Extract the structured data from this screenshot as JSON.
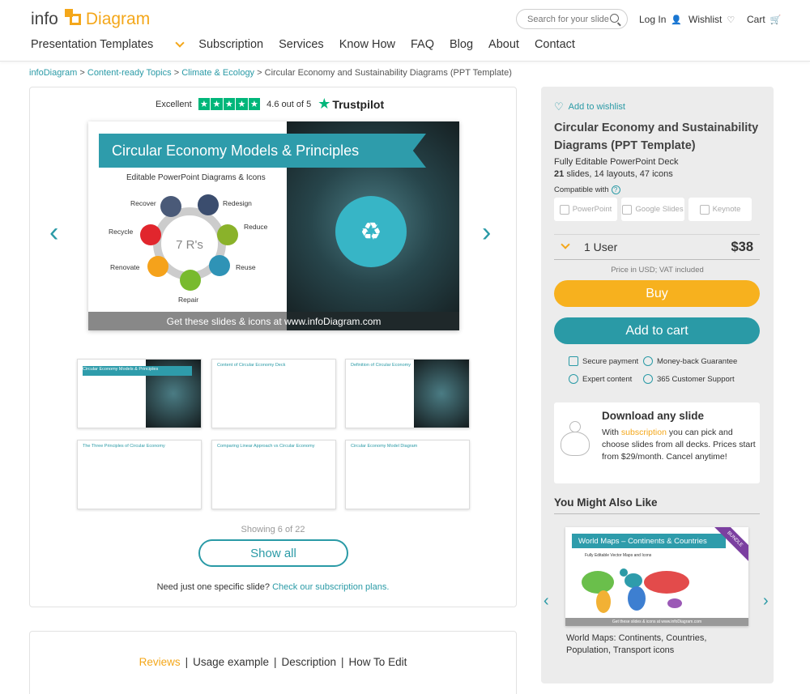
{
  "header": {
    "logo_info": "info",
    "logo_diagram": "Diagram",
    "search_placeholder": "Search for your slide",
    "login": "Log In",
    "wishlist": "Wishlist",
    "cart": "Cart",
    "nav": [
      "Presentation Templates",
      "Subscription",
      "Services",
      "Know How",
      "FAQ",
      "Blog",
      "About",
      "Contact"
    ]
  },
  "breadcrumb": {
    "items": [
      "infoDiagram",
      "Content-ready Topics",
      "Climate & Ecology"
    ],
    "current": "Circular Economy and Sustainability Diagrams (PPT Template)",
    "sep": ">"
  },
  "trustpilot": {
    "excellent": "Excellent",
    "score": "4.6 out of 5",
    "brand": "Trustpilot"
  },
  "hero": {
    "title": "Circular Economy Models & Principles",
    "subtitle": "Editable PowerPoint Diagrams & Icons",
    "center": "7 R's",
    "labels": [
      "Recover",
      "Redesign",
      "Reduce",
      "Reuse",
      "Repair",
      "Renovate",
      "Recycle"
    ],
    "footer": "Get these slides & icons at www.infoDiagram.com"
  },
  "thumbs": [
    {
      "title": "Circular Economy Models & Principles"
    },
    {
      "title": "Content of Circular Economy Deck"
    },
    {
      "title": "Definition of Circular Economy"
    },
    {
      "title": "The Three Principles of Circular Economy"
    },
    {
      "title": "Comparing Linear Approach vs Circular Economy"
    },
    {
      "title": "Circular Economy Model Diagram"
    }
  ],
  "gallery": {
    "showing": "Showing 6 of 22",
    "show_all": "Show all",
    "need_text": "Need just one specific slide?",
    "need_link": "Check our subscription plans."
  },
  "tabs": [
    "Reviews",
    "Usage example",
    "Description",
    "How To Edit"
  ],
  "product": {
    "wishlist": "Add to wishlist",
    "title": "Circular Economy and Sustainability Diagrams (PPT Template)",
    "subtitle": "Fully Editable PowerPoint Deck",
    "slides": "21",
    "counts_rest": "slides, 14 layouts, 47 icons",
    "compatible": "Compatible with",
    "apps": [
      "PowerPoint",
      "Google Slides",
      "Keynote"
    ],
    "license": "1 User",
    "price": "$38",
    "vat": "Price in USD; VAT included",
    "buy": "Buy",
    "add_to_cart": "Add to cart",
    "features": [
      "Secure payment",
      "Money-back Guarantee",
      "Expert content",
      "365 Customer Support"
    ]
  },
  "download": {
    "title": "Download any slide",
    "text_before": "With",
    "link": "subscription",
    "text_after": "you can pick and choose slides from all decks. Prices start from $29/month. Cancel anytime!"
  },
  "also_like": {
    "heading": "You Might Also Like",
    "item_title": "World Maps: Continents, Countries, Population, Transport icons",
    "thumb_title": "World Maps – Continents & Countries",
    "thumb_sub": "Fully Editable Vector Maps and Icons",
    "bundle": "BUNDLE",
    "thumb_footer": "Get these slides & icons at www.infoDiagram.com"
  },
  "colors": {
    "teal": "#2a9aa6",
    "orange": "#f4a71a",
    "trustpilot_green": "#00b67a"
  }
}
